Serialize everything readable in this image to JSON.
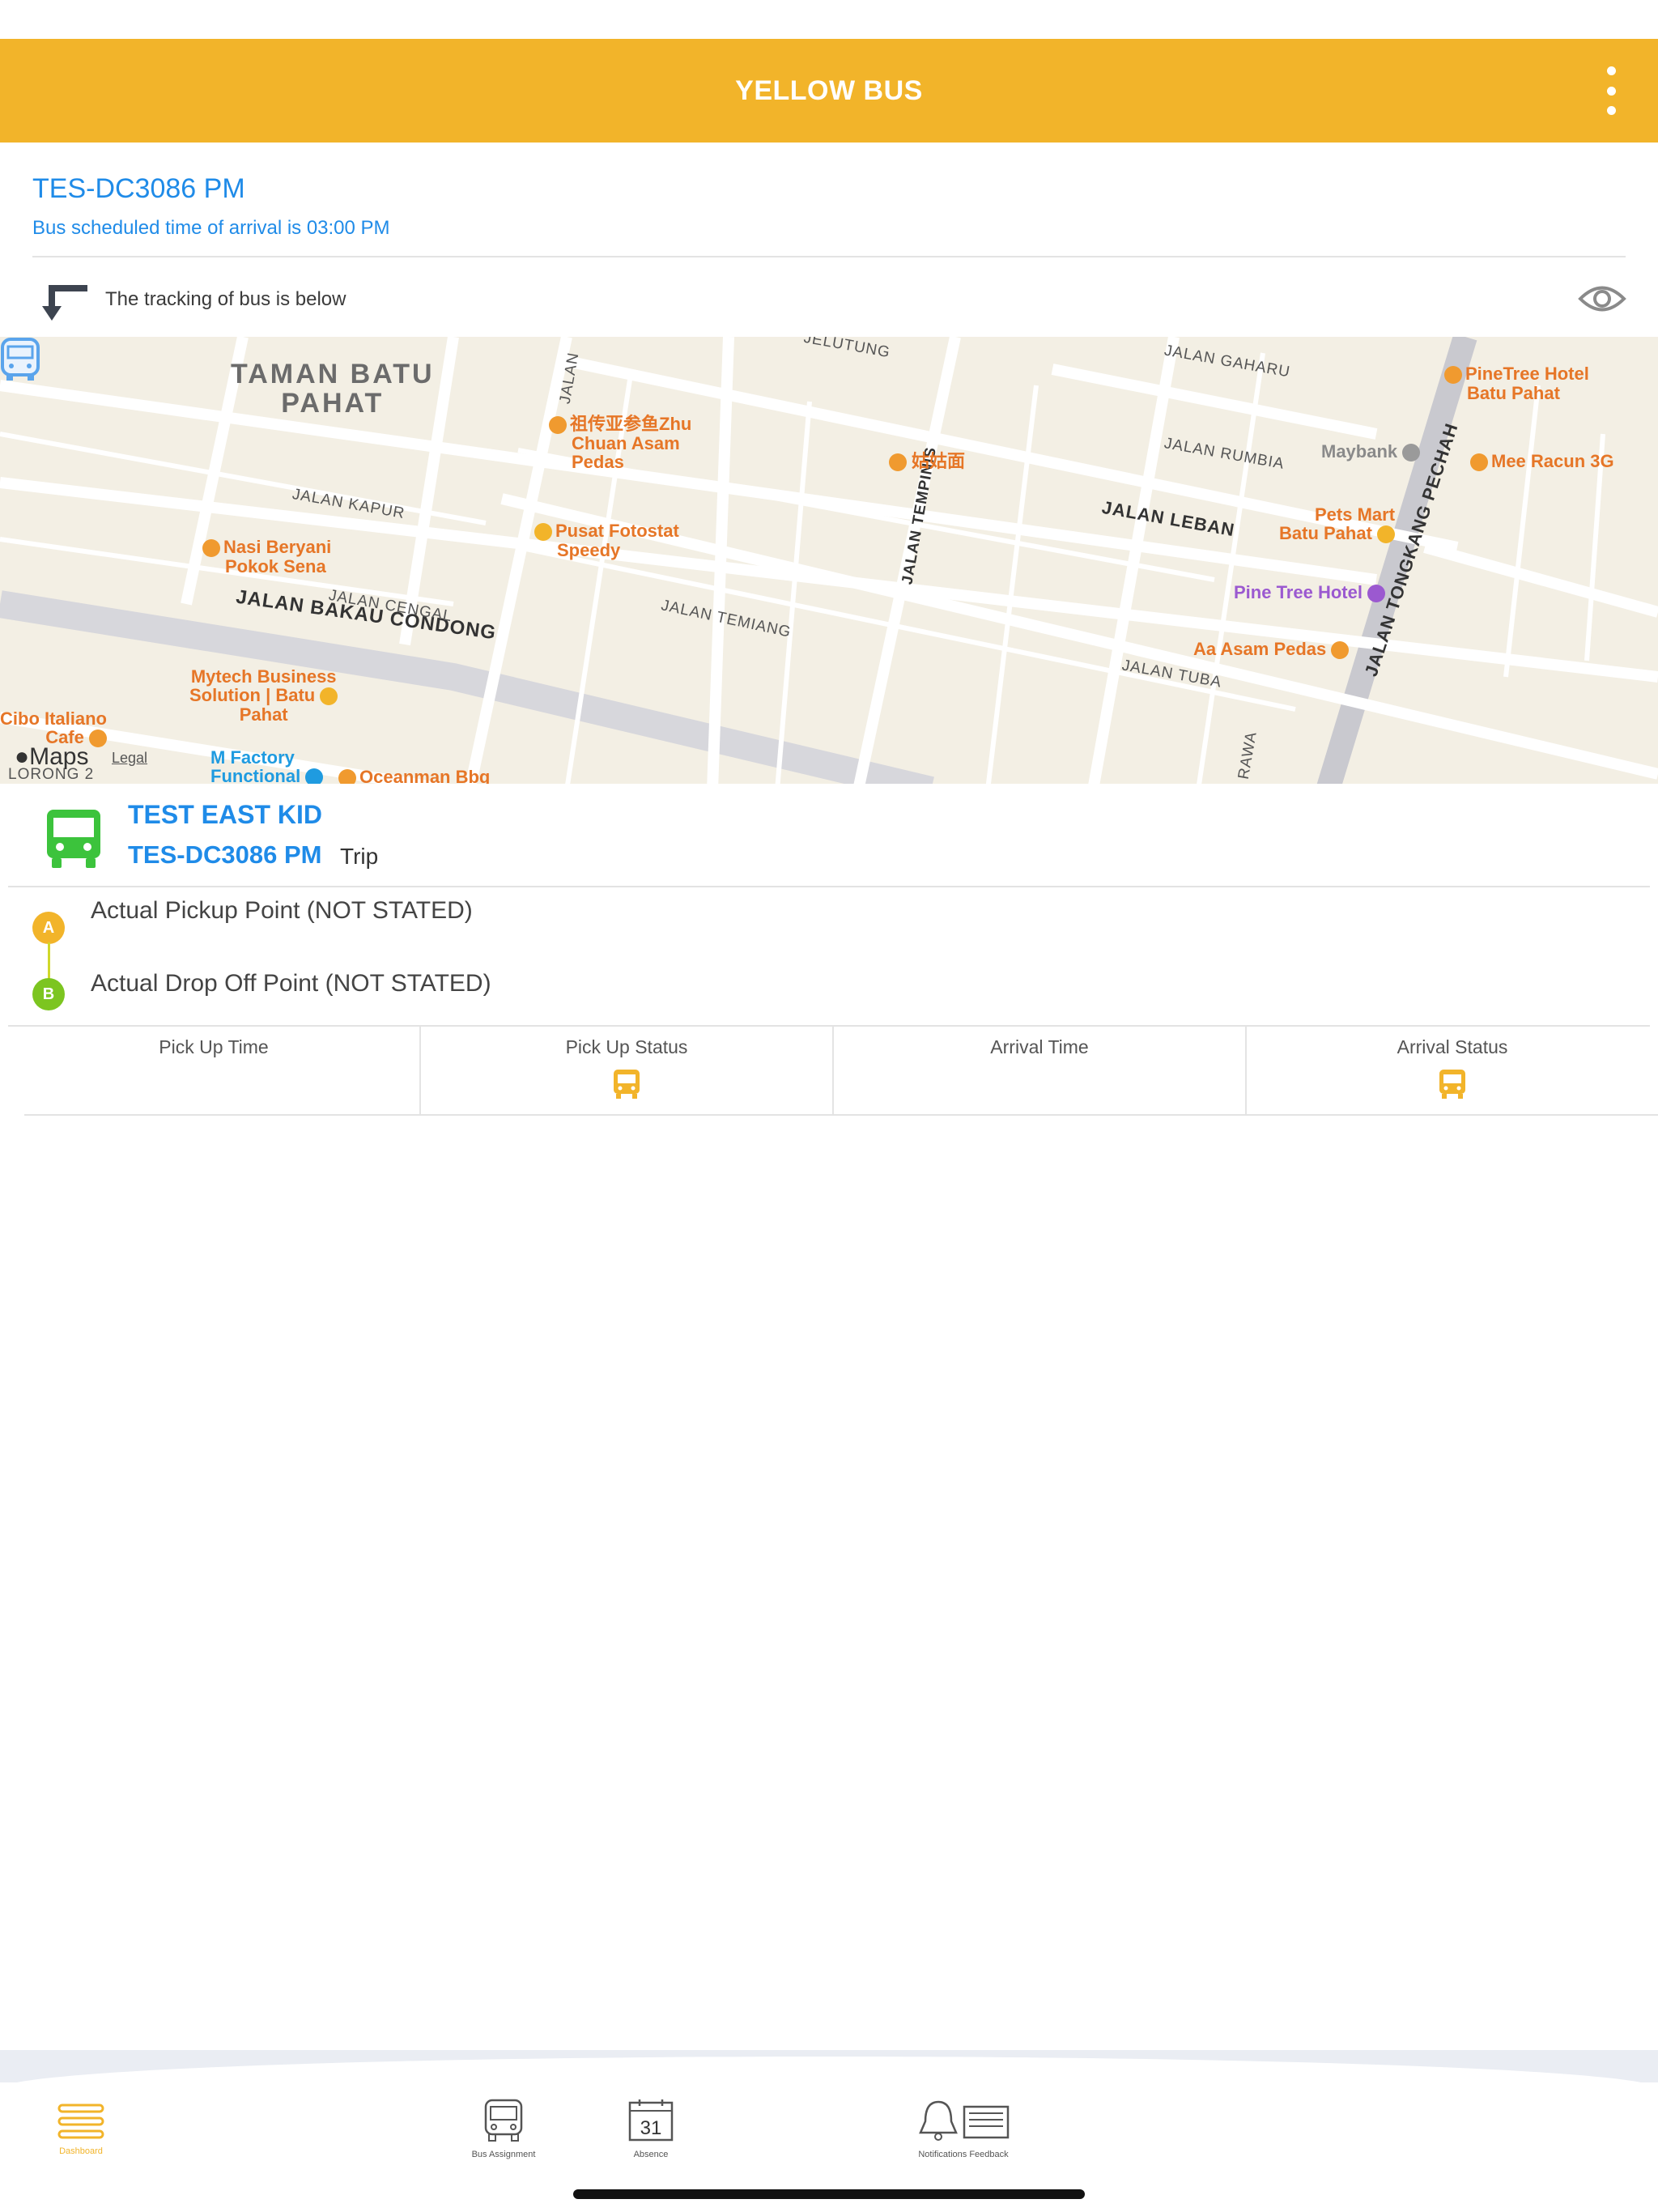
{
  "header": {
    "title": "YELLOW BUS",
    "background_color": "#f2b42a",
    "menu_icon": "more-vertical-icon"
  },
  "trip": {
    "title": "TES-DC3086 PM",
    "scheduled_text": "Bus scheduled time of arrival is 03:00 PM",
    "accent_color": "#1f8be8"
  },
  "tracking": {
    "text": "The tracking of bus is below",
    "left_icon": "turn-down-arrow-icon",
    "right_icon": "eye-icon"
  },
  "map": {
    "area_labels": [
      "TAMAN BATU",
      "PAHAT"
    ],
    "roads": [
      "JALAN BAKAU CONDONG",
      "JALAN LEBAN",
      "JALAN TEMPINIS",
      "JALAN TONGKANG PECHAH",
      "JALAN KAPUR",
      "JALAN CENGAL",
      "JALAN TEMIANG",
      "JALAN TUBA",
      "JALAN RUMBIA",
      "JALAN GAHARU",
      "JELUTUNG",
      "JALAN"
    ],
    "pois": {
      "zhu_chuan": [
        "祖传亚参鱼Zhu",
        "Chuan Asam",
        "Pedas"
      ],
      "gugumian": "姑姑面",
      "maybank": "Maybank",
      "pinetree": [
        "PineTree Hotel",
        "Batu Pahat"
      ],
      "mee_racun": "Mee Racun 3G",
      "pets_mart": [
        "Pets Mart",
        "Batu Pahat"
      ],
      "pine_tree_hotel": "Pine Tree Hotel",
      "aa_asam": "Aa Asam Pedas",
      "nasi_beryani": [
        "Nasi Beryani",
        "Pokok Sena"
      ],
      "pusat_fotostat": [
        "Pusat Fotostat",
        "Speedy"
      ],
      "mytech": [
        "Mytech Business",
        "Solution | Batu",
        "Pahat"
      ],
      "cibo": [
        "Cibo Italiano",
        "Cafe"
      ],
      "m_factory": [
        "M Factory",
        "Functional"
      ],
      "oceanman": "Oceanman Bbq",
      "lorong": "LORONG 2",
      "rawa": "RAWA"
    },
    "maps_logo": "Maps",
    "legal_text": "Legal",
    "bus_marker_icon": "bus-marker-icon"
  },
  "student": {
    "name": "TEST EAST KID",
    "trip_code": "TES-DC3086 PM",
    "trip_word": "Trip",
    "icon": "bus-icon",
    "icon_color": "#3cc33c"
  },
  "route": {
    "pin_a": "A",
    "pin_b": "B",
    "pickup": "Actual Pickup Point (NOT STATED)",
    "dropoff": "Actual Drop Off Point (NOT STATED)"
  },
  "status": {
    "columns": [
      {
        "header": "Pick Up Time"
      },
      {
        "header": "Pick Up Status",
        "icon": "bus-icon"
      },
      {
        "header": "Arrival Time"
      },
      {
        "header": "Arrival Status",
        "icon": "bus-icon"
      }
    ]
  },
  "tabbar": {
    "tabs": [
      {
        "label": "Dashboard",
        "icon": "menu-lines-icon",
        "active": true
      },
      {
        "label": "Bus Assignment",
        "icon": "bus-icon",
        "active": false
      },
      {
        "label": "Absence",
        "icon": "calendar-icon",
        "active": false,
        "badge": "31"
      },
      {
        "label": "Notifications Feedback",
        "icon": "bell-feedback-icon",
        "active": false
      }
    ]
  }
}
